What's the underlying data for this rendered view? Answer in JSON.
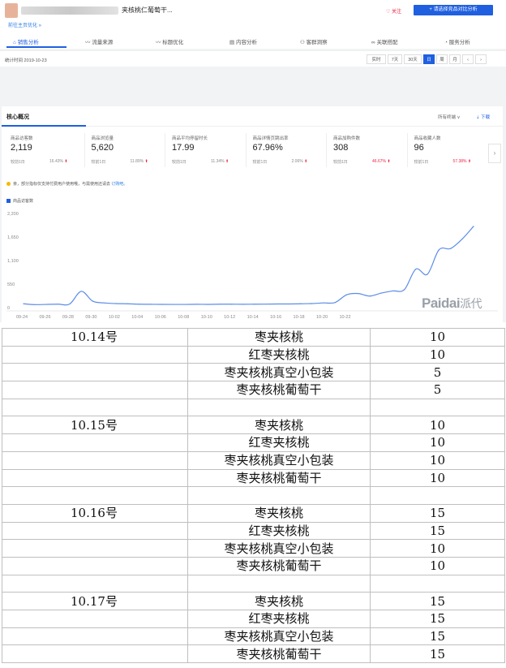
{
  "header": {
    "product_title": "夹核桃仁葡萄干...",
    "sub_link": "前往主页优化 »",
    "follow": "♡ 关注",
    "compare_button": "+ 请选择竞品对比分析"
  },
  "tabs": [
    {
      "label": "⌂ 销售分析",
      "active": true
    },
    {
      "label": "〰 流量来源",
      "active": false
    },
    {
      "label": "〰 标题优化",
      "active": false
    },
    {
      "label": "▤ 内容分析",
      "active": false
    },
    {
      "label": "⚇ 客群洞察",
      "active": false
    },
    {
      "label": "∞ 关联搭配",
      "active": false
    },
    {
      "label": "◔ 服务分析",
      "active": false
    }
  ],
  "datebar": {
    "stat_time": "统计时间 2019-10-23",
    "buttons": [
      {
        "label": "实时",
        "active": false
      },
      {
        "label": "7天",
        "active": false
      },
      {
        "label": "30天",
        "active": false
      },
      {
        "label": "日",
        "active": true
      },
      {
        "label": "周",
        "active": false
      },
      {
        "label": "月",
        "active": false
      },
      {
        "label": "‹",
        "active": false
      },
      {
        "label": "›",
        "active": false
      }
    ]
  },
  "core": {
    "title": "核心概况",
    "all_terminals": "所有终端 ∨",
    "download": "⇣ 下载",
    "metrics": [
      {
        "name": "商品访客数",
        "value": "2,119",
        "compare": "较前1日",
        "pct": "16.43%",
        "highlight": false
      },
      {
        "name": "商品浏览量",
        "value": "5,620",
        "compare": "较前1日",
        "pct": "11.89%",
        "highlight": false
      },
      {
        "name": "商品平均停留时长",
        "value": "17.99",
        "compare": "较前1日",
        "pct": "11.34%",
        "highlight": false
      },
      {
        "name": "商品详情页跳出率",
        "value": "67.96%",
        "compare": "较前1日",
        "pct": "2.06%",
        "highlight": false
      },
      {
        "name": "商品加购件数",
        "value": "308",
        "compare": "较前1日",
        "pct": "46.67%",
        "highlight": true
      },
      {
        "name": "商品收藏人数",
        "value": "96",
        "compare": "较前1日",
        "pct": "57.38%",
        "highlight": true
      }
    ],
    "notice_text": "亲，部分指标仅支持付费用户使用哦，与需使用还请去",
    "notice_link": "订购吧。",
    "legend": "商品访客数",
    "watermark_latin": "Paidai",
    "watermark_cn": "派代"
  },
  "chart_data": {
    "type": "line",
    "series": [
      {
        "name": "商品访客数",
        "values": [
          90,
          70,
          75,
          80,
          85,
          380,
          150,
          110,
          95,
          90,
          80,
          78,
          76,
          75,
          75,
          78,
          76,
          80,
          80,
          78,
          80,
          82,
          85,
          85,
          90,
          95,
          110,
          120,
          300,
          330,
          270,
          340,
          390,
          420,
          900,
          780,
          1350,
          1380,
          1600,
          1900
        ]
      }
    ],
    "xticks": [
      "09-24",
      "09-26",
      "09-28",
      "09-30",
      "10-02",
      "10-04",
      "10-06",
      "10-08",
      "10-10",
      "10-12",
      "10-14",
      "10-16",
      "10-18",
      "10-20",
      "10-22"
    ],
    "yticks": [
      "0",
      "550",
      "1,100",
      "1,650",
      "2,200"
    ],
    "ylim": [
      0,
      2200
    ],
    "color": "#5b8de8",
    "grid": false
  },
  "table": {
    "days": [
      {
        "date": "10.14号",
        "items": [
          {
            "name": "枣夹核桃",
            "qty": "10"
          },
          {
            "name": "红枣夹核桃",
            "qty": "10"
          },
          {
            "name": "枣夹核桃真空小包装",
            "qty": "5"
          },
          {
            "name": "枣夹核桃葡萄干",
            "qty": "5"
          }
        ]
      },
      {
        "date": "10.15号",
        "items": [
          {
            "name": "枣夹核桃",
            "qty": "10"
          },
          {
            "name": "红枣夹核桃",
            "qty": "10"
          },
          {
            "name": "枣夹核桃真空小包装",
            "qty": "10"
          },
          {
            "name": "枣夹核桃葡萄干",
            "qty": "10"
          }
        ]
      },
      {
        "date": "10.16号",
        "items": [
          {
            "name": "枣夹核桃",
            "qty": "15"
          },
          {
            "name": "红枣夹核桃",
            "qty": "15"
          },
          {
            "name": "枣夹核桃真空小包装",
            "qty": "10"
          },
          {
            "name": "枣夹核桃葡萄干",
            "qty": "10"
          }
        ]
      },
      {
        "date": "10.17号",
        "items": [
          {
            "name": "枣夹核桃",
            "qty": "15"
          },
          {
            "name": "红枣夹核桃",
            "qty": "15"
          },
          {
            "name": "枣夹核桃真空小包装",
            "qty": "15"
          },
          {
            "name": "枣夹核桃葡萄干",
            "qty": "15"
          }
        ]
      }
    ]
  }
}
